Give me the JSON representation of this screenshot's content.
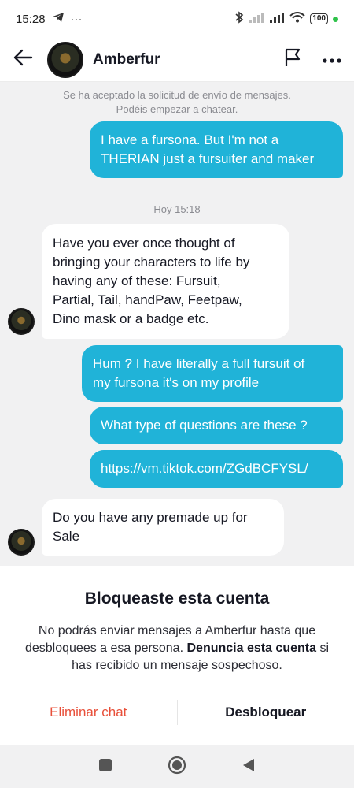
{
  "status_bar": {
    "time": "15:28",
    "extra": "···",
    "battery": "100"
  },
  "header": {
    "name": "Amberfur"
  },
  "system_note": {
    "line1": "Se ha aceptado la solicitud de envío de mensajes.",
    "line2": "Podéis empezar a chatear."
  },
  "timestamp": "Hoy 15:18",
  "messages": [
    {
      "direction": "out",
      "lines": [
        "I have a fursona. But I'm not a",
        "THERIAN just a fursuiter and maker"
      ]
    },
    {
      "direction": "in",
      "lines": [
        "Have you ever once thought of",
        "bringing your characters to life by",
        "having any of these: Fursuit,",
        "Partial, Tail, handPaw, Feetpaw,",
        "Dino mask or a badge etc."
      ]
    },
    {
      "direction": "out",
      "lines": [
        "Hum ? I have literally a full fursuit of",
        "my fursona it's on my profile"
      ]
    },
    {
      "direction": "out",
      "lines": [
        "What type of questions are these ?"
      ]
    },
    {
      "direction": "out",
      "lines": [
        "https://vm.tiktok.com/ZGdBCFYSL/"
      ]
    },
    {
      "direction": "in",
      "lines": [
        "Do you have any premade up for",
        "Sale"
      ]
    }
  ],
  "blocked": {
    "title": "Bloqueaste esta cuenta",
    "desc_part1": "No podrás enviar mensajes a Amberfur hasta que desbloquees a esa persona.",
    "desc_bold": "Denuncia esta cuenta",
    "desc_part2": "si has recibido un mensaje sospechoso.",
    "delete_label": "Eliminar chat",
    "unblock_label": "Desbloquear"
  },
  "colors": {
    "outgoing_bubble": "#20b3d8",
    "delete_action": "#e8503a",
    "status_dot": "#2ec24a"
  },
  "icons": [
    "telegram-icon",
    "bluetooth-icon",
    "signal-icon",
    "wifi-icon",
    "back-arrow-icon",
    "flag-icon",
    "more-icon",
    "square-icon",
    "home-circle-icon",
    "back-triangle-icon"
  ]
}
